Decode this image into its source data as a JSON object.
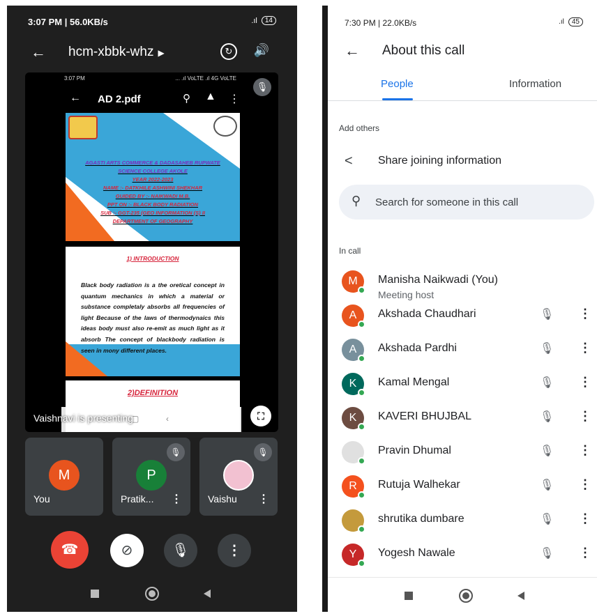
{
  "left": {
    "status_time": "3:07 PM | 56.0KB/s",
    "battery": "14",
    "meeting_code": "hcm-xbbk-whz",
    "presentation": {
      "inner_time": "3:07 PM",
      "inner_status": "... .ıl VoLTE .ıl 4G VoLTE",
      "file_name": "AD 2.pdf",
      "slide1_lines": [
        "AGASTI ARTS COMMERCE & DADASAHEB RUPWATE",
        "SCIENCE COLLEGE AKOLE",
        "YEAR 2022-2023",
        "NAME :- DATKHILE ASHWINI SHEKHAR",
        "GUIDED BY :- NAIKWADI M.B.",
        "PPT ON :- BLACK BODY RADIATION",
        "SUB :- GGT-235 (GEO INFORMATION (S) II",
        "DEPARTMENT OF GEOGRAPHY"
      ],
      "slide2_title": "1) INTRODUCTION",
      "slide2_body": "Black body radiation is a the oretical concept in quantum mechanics in which a material or substance completaly absorbs all frequencies of light Because of the laws of thermodynaics this ideas body must also re-emit as much light as it absorb The concept of blackbody radiation is seen in mony different places.",
      "slide3_title": "2)DEFINITION",
      "presenter_text": "Vaishnavi is presenting"
    },
    "tiles": [
      {
        "name": "You",
        "initial": "M",
        "color": "#e8541e"
      },
      {
        "name": "Pratik...",
        "initial": "P",
        "color": "#188038"
      },
      {
        "name": "Vaishu",
        "initial": "",
        "color": "#f2c1d1"
      }
    ]
  },
  "right": {
    "status_time": "7:30 PM | 22.0KB/s",
    "battery": "45",
    "title": "About this call",
    "tabs": [
      "People",
      "Information"
    ],
    "add_others_label": "Add others",
    "share_label": "Share joining information",
    "search_placeholder": "Search for someone in this call",
    "in_call_label": "In call",
    "host": {
      "name": "Manisha Naikwadi (You)",
      "role": "Meeting host",
      "initial": "M",
      "color": "#e8541e"
    },
    "participants": [
      {
        "name": "Akshada Chaudhari",
        "initial": "A",
        "color": "#e8541e"
      },
      {
        "name": "Akshada Pardhi",
        "initial": "A",
        "color": "#78909c"
      },
      {
        "name": "Kamal Mengal",
        "initial": "K",
        "color": "#00695c"
      },
      {
        "name": "KAVERI BHUJBAL",
        "initial": "K",
        "color": "#6d4c41"
      },
      {
        "name": "Pravin Dhumal",
        "initial": "",
        "color": "#e0e0e0"
      },
      {
        "name": "Rutuja Walhekar",
        "initial": "R",
        "color": "#f4511e"
      },
      {
        "name": "shrutika dumbare",
        "initial": "",
        "color": "#c49a3c"
      },
      {
        "name": "Yogesh Nawale",
        "initial": "Y",
        "color": "#c62828"
      }
    ]
  }
}
